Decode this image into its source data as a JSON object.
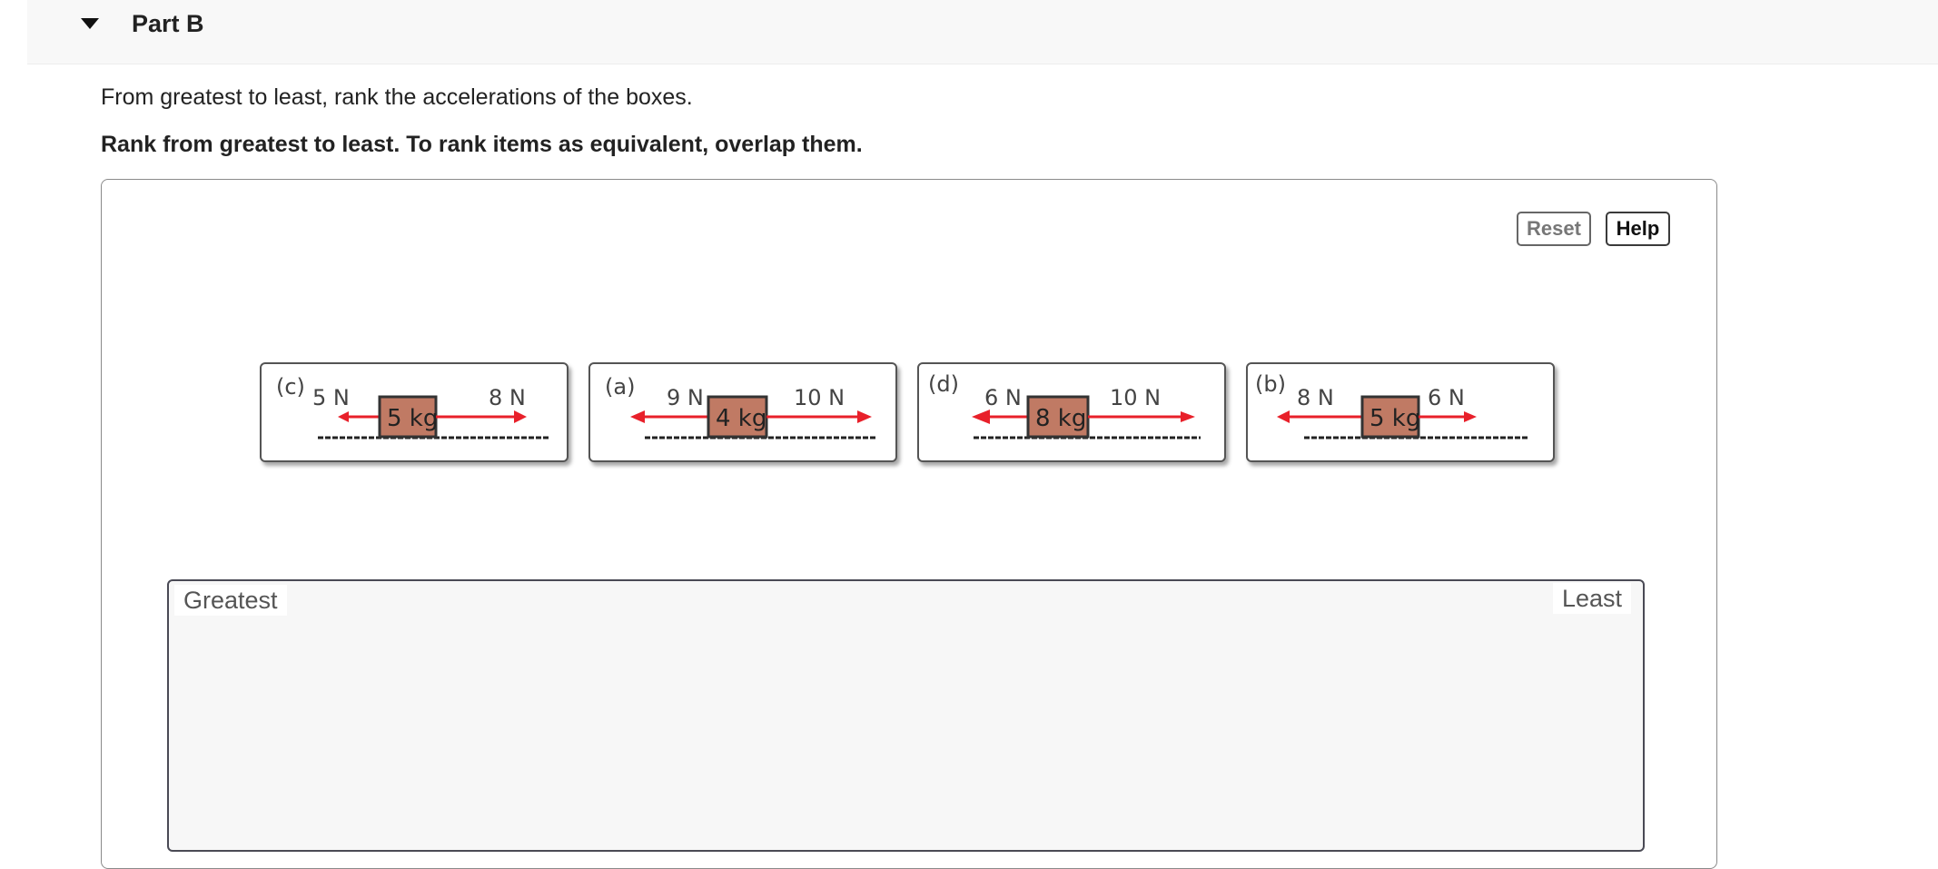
{
  "part": {
    "title": "Part B"
  },
  "question": {
    "text": "From greatest to least, rank the accelerations of the boxes.",
    "instruction": "Rank from greatest to least. To rank items as equivalent, overlap them."
  },
  "controls": {
    "reset_label": "Reset",
    "help_label": "Help"
  },
  "tiles": [
    {
      "label": "(c)",
      "left_force": "5 N",
      "right_force": "8 N",
      "mass": "5 kg"
    },
    {
      "label": "(a)",
      "left_force": "9 N",
      "right_force": "10 N",
      "mass": "4 kg"
    },
    {
      "label": "(d)",
      "left_force": "6 N",
      "right_force": "10 N",
      "mass": "8 kg"
    },
    {
      "label": "(b)",
      "left_force": "8 N",
      "right_force": "6 N",
      "mass": "5 kg"
    }
  ],
  "ranking": {
    "greatest_label": "Greatest",
    "least_label": "Least"
  },
  "colors": {
    "arrow": "#e8202a",
    "box_fill": "#c07a64",
    "box_stroke": "#333333"
  }
}
